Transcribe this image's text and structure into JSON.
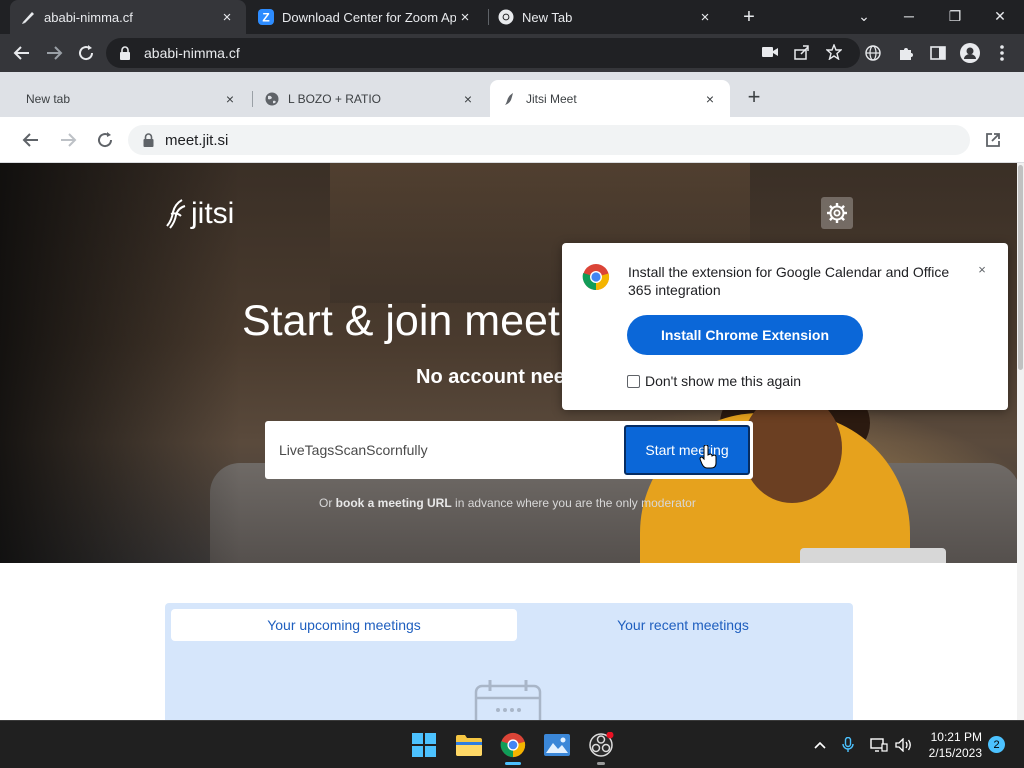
{
  "outer_tabs": [
    {
      "title": "ababi-nimma.cf",
      "close": "×"
    },
    {
      "title": "Download Center for Zoom Apps",
      "close": "×"
    },
    {
      "title": "New Tab",
      "close": "×"
    }
  ],
  "outer_new_tab": "+",
  "window_controls": {
    "minimize": "─",
    "maximize": "❐",
    "close": "✕",
    "tab_search": "⌄"
  },
  "outer_address": "ababi-nimma.cf",
  "inner_tabs": [
    {
      "title": "New tab",
      "close": "×"
    },
    {
      "title": "L BOZO + RATIO",
      "close": "×"
    },
    {
      "title": "Jitsi Meet",
      "close": "×"
    }
  ],
  "inner_new_tab": "+",
  "inner_address": "meet.jit.si",
  "page": {
    "logo_text": "jitsi",
    "headline": "Start & join meeti",
    "subline": "No account nee",
    "room_input_value": "LiveTagsScanScornfully",
    "start_button": "Start meeting",
    "book_prefix": "Or ",
    "book_link": "book a meeting URL",
    "book_suffix": " in advance where you are the only moderator"
  },
  "popup": {
    "message": "Install the extension for Google Calendar and Office 365 integration",
    "close": "×",
    "install_button": "Install Chrome Extension",
    "checkbox_label": "Don't show me this again"
  },
  "meetings": {
    "tab_upcoming": "Your upcoming meetings",
    "tab_recent": "Your recent meetings"
  },
  "taskbar": {
    "time": "10:21 PM",
    "date": "2/15/2023",
    "notifications": "2"
  },
  "colors": {
    "accent_blue": "#0b67d8",
    "chrome_dark": "#202124",
    "chrome_toolbar": "#35363a"
  }
}
